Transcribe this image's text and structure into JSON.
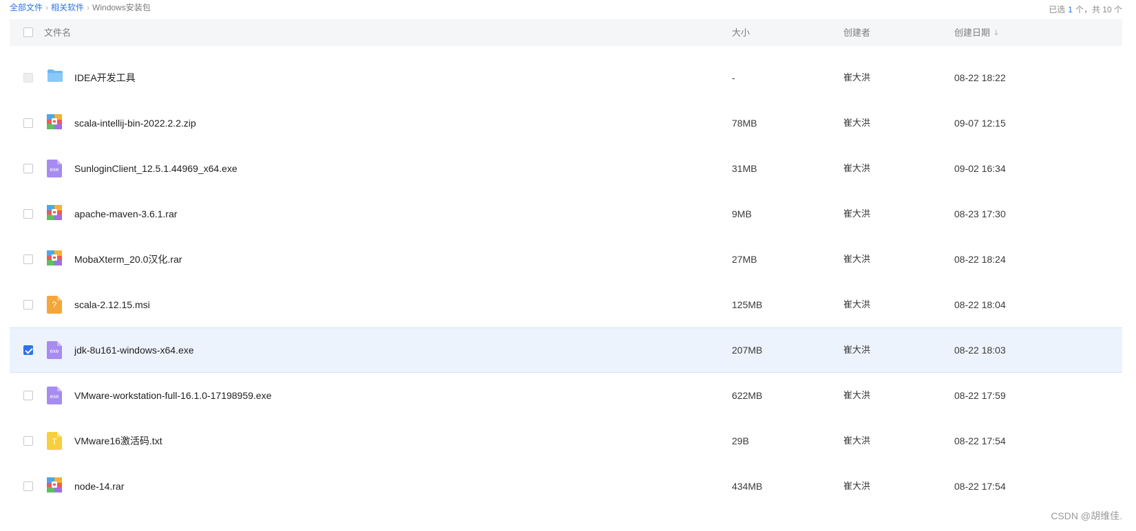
{
  "breadcrumb": {
    "items": [
      "全部文件",
      "相关软件"
    ],
    "current": "Windows安装包"
  },
  "selection": {
    "prefix": "已选",
    "count": "1",
    "suffix": "个，共 10 个"
  },
  "table": {
    "headers": {
      "name": "文件名",
      "size": "大小",
      "creator": "创建者",
      "date": "创建日期"
    },
    "rows": [
      {
        "name": "IDEA开发工具",
        "size": "-",
        "creator": "崔大洪",
        "date": "08-22 18:22",
        "icon": "folder-icon",
        "checked": false,
        "disabled": true
      },
      {
        "name": "scala-intellij-bin-2022.2.2.zip",
        "size": "78MB",
        "creator": "崔大洪",
        "date": "09-07 12:15",
        "icon": "archive-icon",
        "checked": false
      },
      {
        "name": "SunloginClient_12.5.1.44969_x64.exe",
        "size": "31MB",
        "creator": "崔大洪",
        "date": "09-02 16:34",
        "icon": "exe-icon",
        "checked": false
      },
      {
        "name": "apache-maven-3.6.1.rar",
        "size": "9MB",
        "creator": "崔大洪",
        "date": "08-23 17:30",
        "icon": "archive-icon",
        "checked": false
      },
      {
        "name": "MobaXterm_20.0汉化.rar",
        "size": "27MB",
        "creator": "崔大洪",
        "date": "08-22 18:24",
        "icon": "archive-icon",
        "checked": false
      },
      {
        "name": "scala-2.12.15.msi",
        "size": "125MB",
        "creator": "崔大洪",
        "date": "08-22 18:04",
        "icon": "unknown-file-icon",
        "checked": false
      },
      {
        "name": "jdk-8u161-windows-x64.exe",
        "size": "207MB",
        "creator": "崔大洪",
        "date": "08-22 18:03",
        "icon": "exe-icon",
        "checked": true
      },
      {
        "name": "VMware-workstation-full-16.1.0-17198959.exe",
        "size": "622MB",
        "creator": "崔大洪",
        "date": "08-22 17:59",
        "icon": "exe-icon",
        "checked": false
      },
      {
        "name": "VMware16激活码.txt",
        "size": "29B",
        "creator": "崔大洪",
        "date": "08-22 17:54",
        "icon": "text-file-icon",
        "checked": false
      },
      {
        "name": "node-14.rar",
        "size": "434MB",
        "creator": "崔大洪",
        "date": "08-22 17:54",
        "icon": "archive-icon",
        "checked": false
      }
    ]
  },
  "icon_labels": {
    "exe": "exe",
    "unknown": "?",
    "text": "T"
  },
  "watermark": "CSDN @胡维佳.",
  "colors": {
    "accent": "#2b73e6",
    "selected_row": "#edf3fd",
    "header_bg": "#f5f6f8",
    "folder": "#6bb8f5",
    "exe": "#a78bf0",
    "msi": "#f5a63a",
    "txt": "#f7cf3c"
  }
}
